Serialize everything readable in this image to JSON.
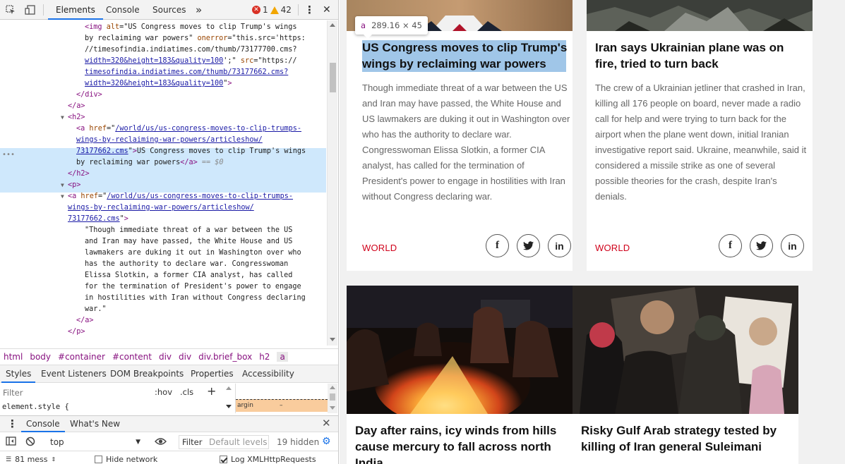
{
  "devtools": {
    "tabs": [
      "Elements",
      "Console",
      "Sources"
    ],
    "more_tabs": "»",
    "errors": "1",
    "warnings": "42",
    "menu": "⋮",
    "close": "✕",
    "code_lines": [
      {
        "t": "<img alt=\"US Congress moves to clip Trump's wings"
      },
      {
        "t": "by reclaiming war powers\" onerror=\"this.src='https:"
      },
      {
        "t": "//timesofindia.indiatimes.com/thumb/73177700.cms?"
      },
      {
        "t": "width=320&height=183&quality=100';\" src=\"https://"
      },
      {
        "t": "timesofindia.indiatimes.com/thumb/73177662.cms?"
      },
      {
        "t": "width=320&height=183&quality=100\">"
      },
      {
        "t": "</div>"
      },
      {
        "t": "</a>"
      },
      {
        "t": "<h2>"
      },
      {
        "t": "<a href=\"/world/us/us-congress-moves-to-clip-trumps-"
      },
      {
        "t": "wings-by-reclaiming-war-powers/articleshow/"
      },
      {
        "t": "73177662.cms\">US Congress moves to clip Trump's wings"
      },
      {
        "t": "by reclaiming war powers</a> == $0"
      },
      {
        "t": "</h2>"
      },
      {
        "t": "<p>"
      },
      {
        "t": "<a href=\"/world/us/us-congress-moves-to-clip-trumps-"
      },
      {
        "t": "wings-by-reclaiming-war-powers/articleshow/"
      },
      {
        "t": "73177662.cms\">"
      },
      {
        "t": "\"Though immediate threat of a war between the US"
      },
      {
        "t": "and Iran may have passed, the White House and US"
      },
      {
        "t": "lawmakers are duking it out in Washington over who"
      },
      {
        "t": "has the authority to declare war. Congresswoman"
      },
      {
        "t": "Elissa Slotkin, a former CIA analyst, has called"
      },
      {
        "t": "for the termination of President's power to engage"
      },
      {
        "t": "in hostilities with Iran without Congress declaring"
      },
      {
        "t": "war.\""
      },
      {
        "t": "</a>"
      },
      {
        "t": "</p>"
      }
    ],
    "breadcrumbs": [
      "html",
      "body",
      "#container",
      "#content",
      "div",
      "div",
      "div.brief_box",
      "h2",
      "a"
    ],
    "subtabs": [
      "Styles",
      "Event Listeners",
      "DOM Breakpoints",
      "Properties",
      "Accessibility"
    ],
    "styles_filter_placeholder": "Filter",
    "hov": ":hov",
    "cls": ".cls",
    "plus": "+",
    "element_style": "element.style {",
    "box_margin": "argin",
    "box_margin_val": "–",
    "drawer_tabs": [
      "Console",
      "What's New"
    ],
    "context": "top",
    "console_filter_label": "Filter",
    "console_filter_placeholder": "Default levels",
    "hidden_count": "19 hidden",
    "bottom": {
      "messages": "81 mess",
      "hide_network": "Hide network",
      "log_xhr": "Log XMLHttpRequests"
    }
  },
  "page": {
    "tooltip": {
      "tag": "a",
      "dims": "289.16 × 45"
    },
    "cards": [
      {
        "title": "US Congress moves to clip Trump's wings by reclaiming war powers",
        "text": "Though immediate threat of a war between the US and Iran may have passed, the White House and US lawmakers are duking it out in Washington over who has the authority to declare war. Congresswoman Elissa Slotkin, a former CIA analyst, has called for the termination of President's power to engage in hostilities with Iran without Congress declaring war.",
        "category": "WORLD"
      },
      {
        "title": "Iran says Ukrainian plane was on fire, tried to turn back",
        "text": "The crew of a Ukrainian jetliner that crashed in Iran, killing all 176 people on board, never made a radio call for help and were trying to turn back for the airport when the plane went down, initial Iranian investigative report said. Ukraine, meanwhile, said it considered a missile strike as one of several possible theories for the crash, despite Iran's denials.",
        "category": "WORLD"
      },
      {
        "title": "Day after rains, icy winds from hills cause mercury to fall across north India"
      },
      {
        "title": "Risky Gulf Arab strategy tested by killing of Iran general Suleimani"
      }
    ],
    "share": {
      "facebook": "f",
      "twitter": "t",
      "linkedin": "in"
    },
    "colors": {
      "category": "#d0021b",
      "highlight": "#6fa8dc",
      "selected_row": "#cfe8fc",
      "accent": "#1a73e8"
    }
  }
}
